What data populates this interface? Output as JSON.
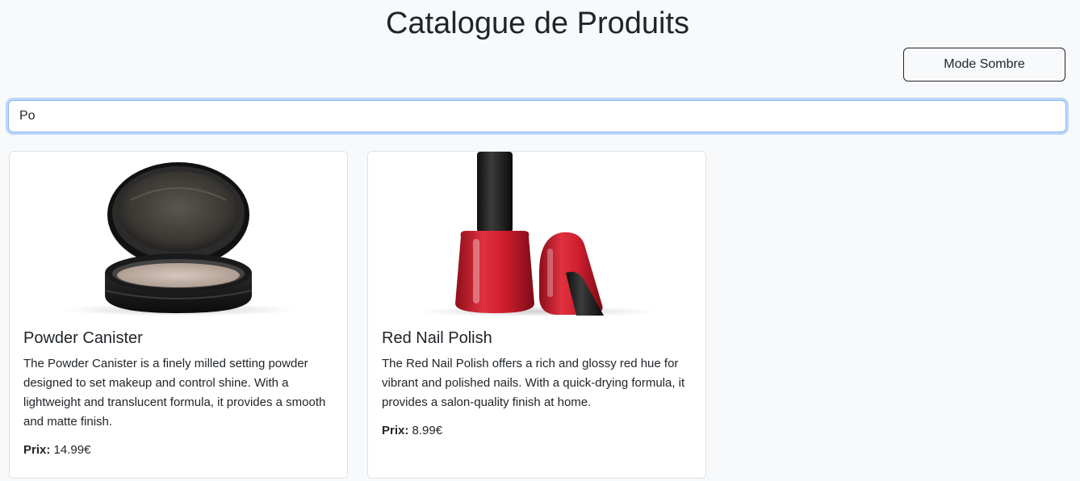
{
  "header": {
    "title": "Catalogue de Produits",
    "theme_button_label": "Mode Sombre"
  },
  "search": {
    "value": "Po",
    "placeholder": ""
  },
  "products": [
    {
      "name": "Powder Canister",
      "description": "The Powder Canister is a finely milled setting powder designed to set makeup and control shine. With a lightweight and translucent formula, it provides a smooth and matte finish.",
      "price_label": "Prix:",
      "price": "14.99€",
      "image_icon": "powder-compact"
    },
    {
      "name": "Red Nail Polish",
      "description": "The Red Nail Polish offers a rich and glossy red hue for vibrant and polished nails. With a quick-drying formula, it provides a salon-quality finish at home.",
      "price_label": "Prix:",
      "price": "8.99€",
      "image_icon": "nail-polish-bottles"
    }
  ],
  "colors": {
    "background": "#f8f9fa",
    "focus_border": "#86b7fe",
    "polish_red": "#d21f2f"
  }
}
